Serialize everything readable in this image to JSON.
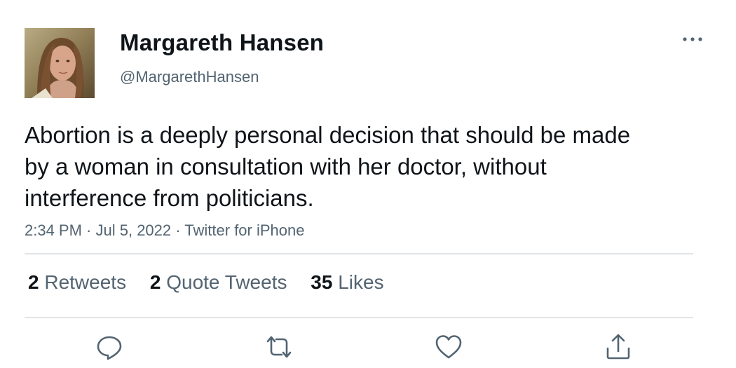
{
  "user": {
    "display_name": "Margareth Hansen",
    "handle": "@MargarethHansen"
  },
  "tweet": {
    "text": "Abortion is a deeply personal decision that should be made by a woman in consultation with her doctor, without interference from politicians.",
    "time": "2:34 PM",
    "date": "Jul 5, 2022",
    "source": "Twitter for iPhone",
    "separator": " · "
  },
  "stats": {
    "retweets_count": "2",
    "retweets_label": "Retweets",
    "quotes_count": "2",
    "quotes_label": "Quote Tweets",
    "likes_count": "35",
    "likes_label": "Likes"
  },
  "icons": {
    "more": "more-horizontal-icon",
    "reply": "reply-icon",
    "retweet": "retweet-icon",
    "like": "heart-icon",
    "share": "share-icon"
  },
  "colors": {
    "text_primary": "#0f1419",
    "text_secondary": "#536471",
    "divider": "#e1e4e6"
  }
}
